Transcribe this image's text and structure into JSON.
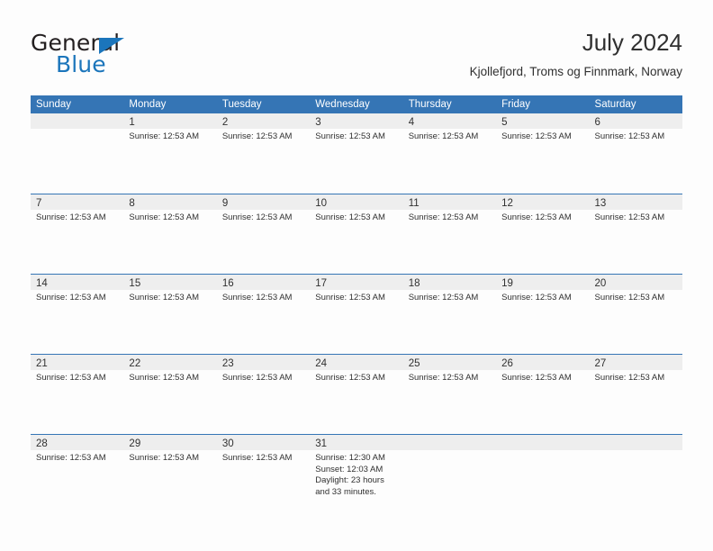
{
  "brand": {
    "name_part1": "General",
    "name_part2": "Blue",
    "accent_color": "#1b75bb"
  },
  "header": {
    "title": "July 2024",
    "subtitle": "Kjollefjord, Troms og Finnmark, Norway"
  },
  "theme": {
    "header_bar_color": "#3575b5",
    "day_band_color": "#eeeeee",
    "text_color": "#303030",
    "page_background": "#fdfdfd"
  },
  "calendar": {
    "day_headers": [
      "Sunday",
      "Monday",
      "Tuesday",
      "Wednesday",
      "Thursday",
      "Friday",
      "Saturday"
    ],
    "weeks": [
      [
        {
          "day": "",
          "lines": []
        },
        {
          "day": "1",
          "lines": [
            "Sunrise: 12:53 AM"
          ]
        },
        {
          "day": "2",
          "lines": [
            "Sunrise: 12:53 AM"
          ]
        },
        {
          "day": "3",
          "lines": [
            "Sunrise: 12:53 AM"
          ]
        },
        {
          "day": "4",
          "lines": [
            "Sunrise: 12:53 AM"
          ]
        },
        {
          "day": "5",
          "lines": [
            "Sunrise: 12:53 AM"
          ]
        },
        {
          "day": "6",
          "lines": [
            "Sunrise: 12:53 AM"
          ]
        }
      ],
      [
        {
          "day": "7",
          "lines": [
            "Sunrise: 12:53 AM"
          ]
        },
        {
          "day": "8",
          "lines": [
            "Sunrise: 12:53 AM"
          ]
        },
        {
          "day": "9",
          "lines": [
            "Sunrise: 12:53 AM"
          ]
        },
        {
          "day": "10",
          "lines": [
            "Sunrise: 12:53 AM"
          ]
        },
        {
          "day": "11",
          "lines": [
            "Sunrise: 12:53 AM"
          ]
        },
        {
          "day": "12",
          "lines": [
            "Sunrise: 12:53 AM"
          ]
        },
        {
          "day": "13",
          "lines": [
            "Sunrise: 12:53 AM"
          ]
        }
      ],
      [
        {
          "day": "14",
          "lines": [
            "Sunrise: 12:53 AM"
          ]
        },
        {
          "day": "15",
          "lines": [
            "Sunrise: 12:53 AM"
          ]
        },
        {
          "day": "16",
          "lines": [
            "Sunrise: 12:53 AM"
          ]
        },
        {
          "day": "17",
          "lines": [
            "Sunrise: 12:53 AM"
          ]
        },
        {
          "day": "18",
          "lines": [
            "Sunrise: 12:53 AM"
          ]
        },
        {
          "day": "19",
          "lines": [
            "Sunrise: 12:53 AM"
          ]
        },
        {
          "day": "20",
          "lines": [
            "Sunrise: 12:53 AM"
          ]
        }
      ],
      [
        {
          "day": "21",
          "lines": [
            "Sunrise: 12:53 AM"
          ]
        },
        {
          "day": "22",
          "lines": [
            "Sunrise: 12:53 AM"
          ]
        },
        {
          "day": "23",
          "lines": [
            "Sunrise: 12:53 AM"
          ]
        },
        {
          "day": "24",
          "lines": [
            "Sunrise: 12:53 AM"
          ]
        },
        {
          "day": "25",
          "lines": [
            "Sunrise: 12:53 AM"
          ]
        },
        {
          "day": "26",
          "lines": [
            "Sunrise: 12:53 AM"
          ]
        },
        {
          "day": "27",
          "lines": [
            "Sunrise: 12:53 AM"
          ]
        }
      ],
      [
        {
          "day": "28",
          "lines": [
            "Sunrise: 12:53 AM"
          ]
        },
        {
          "day": "29",
          "lines": [
            "Sunrise: 12:53 AM"
          ]
        },
        {
          "day": "30",
          "lines": [
            "Sunrise: 12:53 AM"
          ]
        },
        {
          "day": "31",
          "lines": [
            "Sunrise: 12:30 AM",
            "Sunset: 12:03 AM",
            "Daylight: 23 hours and 33 minutes."
          ]
        },
        {
          "day": "",
          "lines": []
        },
        {
          "day": "",
          "lines": []
        },
        {
          "day": "",
          "lines": []
        }
      ]
    ]
  }
}
